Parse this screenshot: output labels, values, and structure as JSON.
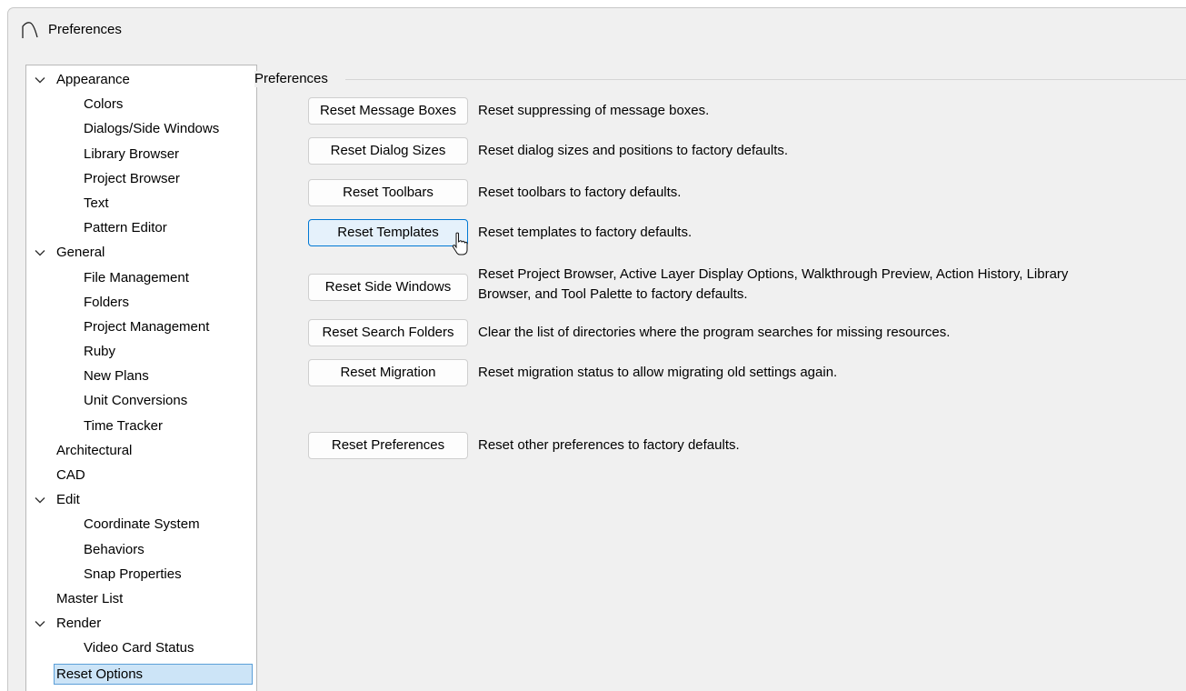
{
  "window": {
    "title": "Preferences"
  },
  "tree": {
    "items": [
      {
        "label": "Appearance",
        "level": 0,
        "expanded": true
      },
      {
        "label": "Colors",
        "level": 1
      },
      {
        "label": "Dialogs/Side Windows",
        "level": 1
      },
      {
        "label": "Library Browser",
        "level": 1
      },
      {
        "label": "Project Browser",
        "level": 1
      },
      {
        "label": "Text",
        "level": 1
      },
      {
        "label": "Pattern Editor",
        "level": 1
      },
      {
        "label": "General",
        "level": 0,
        "expanded": true
      },
      {
        "label": "File Management",
        "level": 1
      },
      {
        "label": "Folders",
        "level": 1
      },
      {
        "label": "Project Management",
        "level": 1
      },
      {
        "label": "Ruby",
        "level": 1
      },
      {
        "label": "New Plans",
        "level": 1
      },
      {
        "label": "Unit Conversions",
        "level": 1
      },
      {
        "label": "Time Tracker",
        "level": 1
      },
      {
        "label": "Architectural",
        "level": 0
      },
      {
        "label": "CAD",
        "level": 0
      },
      {
        "label": "Edit",
        "level": 0,
        "expanded": true
      },
      {
        "label": "Coordinate System",
        "level": 1
      },
      {
        "label": "Behaviors",
        "level": 1
      },
      {
        "label": "Snap Properties",
        "level": 1
      },
      {
        "label": "Master List",
        "level": 0
      },
      {
        "label": "Render",
        "level": 0,
        "expanded": true
      },
      {
        "label": "Video Card Status",
        "level": 1
      },
      {
        "label": "Reset Options",
        "level": 0,
        "selected": true
      }
    ]
  },
  "panel": {
    "group_title": "Preferences",
    "rows": [
      {
        "button": "Reset Message Boxes",
        "description": [
          "Reset suppressing of message boxes."
        ]
      },
      {
        "button": "Reset Dialog Sizes",
        "description": [
          "Reset dialog sizes and positions to factory defaults."
        ]
      },
      {
        "button": "Reset Toolbars",
        "description": [
          "Reset toolbars to factory defaults."
        ]
      },
      {
        "button": "Reset Templates",
        "description": [
          "Reset templates to factory defaults."
        ],
        "hovered": true
      },
      {
        "button": "Reset Side Windows",
        "description": [
          "Reset Project Browser, Active Layer Display Options, Walkthrough Preview, Action History, Library",
          "Browser, and Tool Palette to factory defaults."
        ]
      },
      {
        "button": "Reset Search Folders",
        "description": [
          "Clear the list of directories where the program searches for missing resources."
        ]
      },
      {
        "button": "Reset Migration",
        "description": [
          "Reset migration status to allow migrating old settings again."
        ]
      },
      {
        "button": "Reset Preferences",
        "description": [
          "Reset other preferences to factory defaults."
        ]
      }
    ]
  },
  "colors": {
    "window_bg": "#f0f0f0",
    "selection_bg": "#cce4f7",
    "selection_border": "#5c9fd8",
    "hover_bg": "#e5f1fb",
    "hover_border": "#0078d4"
  }
}
